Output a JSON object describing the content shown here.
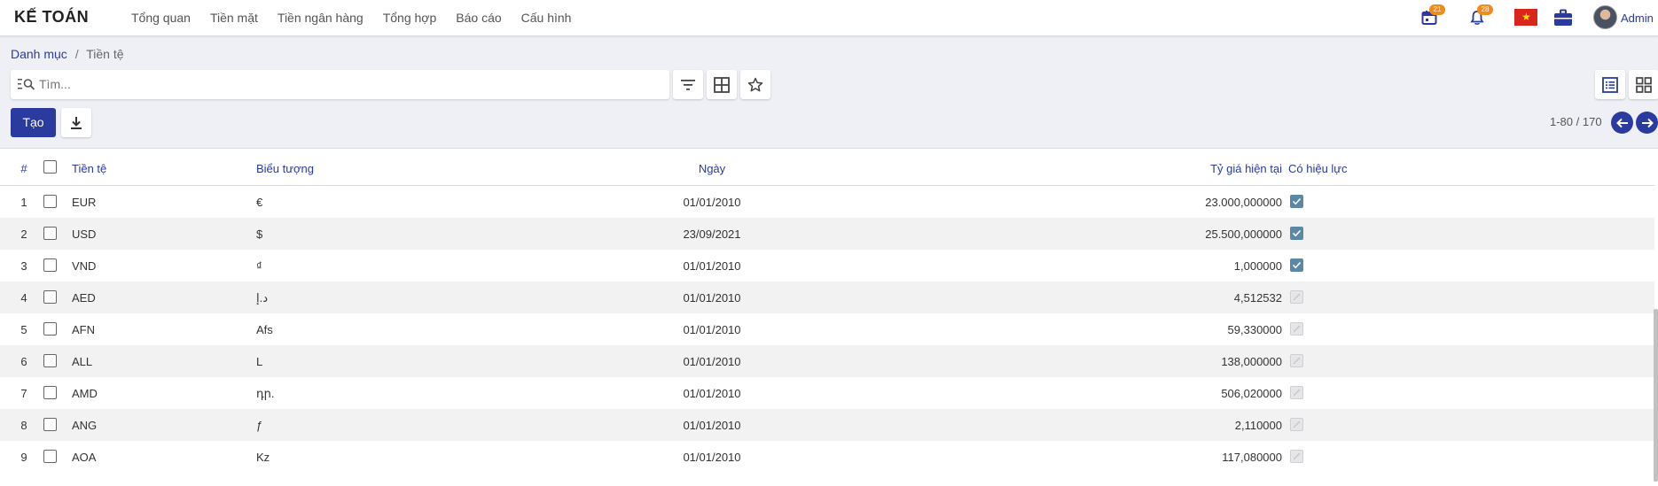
{
  "app": {
    "brand": "KẾ TOÁN",
    "menu": [
      "Tổng quan",
      "Tiền mặt",
      "Tiền ngân hàng",
      "Tổng hợp",
      "Báo cáo",
      "Cấu hình"
    ],
    "calendar_badge": "21",
    "notification_badge": "28",
    "user_name": "Admin"
  },
  "breadcrumb": {
    "parent": "Danh mục",
    "separator": "/",
    "current": "Tiền tệ"
  },
  "search": {
    "placeholder": "Tìm..."
  },
  "toolbar": {
    "create_label": "Tạo",
    "pager_text": "1-80 / 170"
  },
  "table": {
    "headers": {
      "num": "#",
      "currency": "Tiền tệ",
      "symbol": "Biểu tượng",
      "date": "Ngày",
      "rate": "Tỷ giá hiện tại",
      "active": "Có hiệu lực"
    },
    "rows": [
      {
        "num": "1",
        "currency": "EUR",
        "symbol": "€",
        "date": "01/01/2010",
        "rate": "23.000,000000",
        "active": true
      },
      {
        "num": "2",
        "currency": "USD",
        "symbol": "$",
        "date": "23/09/2021",
        "rate": "25.500,000000",
        "active": true
      },
      {
        "num": "3",
        "currency": "VND",
        "symbol": "₫",
        "date": "01/01/2010",
        "rate": "1,000000",
        "active": true
      },
      {
        "num": "4",
        "currency": "AED",
        "symbol": "د.إ",
        "date": "01/01/2010",
        "rate": "4,512532",
        "active": false
      },
      {
        "num": "5",
        "currency": "AFN",
        "symbol": "Afs",
        "date": "01/01/2010",
        "rate": "59,330000",
        "active": false
      },
      {
        "num": "6",
        "currency": "ALL",
        "symbol": "L",
        "date": "01/01/2010",
        "rate": "138,000000",
        "active": false
      },
      {
        "num": "7",
        "currency": "AMD",
        "symbol": "դր.",
        "date": "01/01/2010",
        "rate": "506,020000",
        "active": false
      },
      {
        "num": "8",
        "currency": "ANG",
        "symbol": "ƒ",
        "date": "01/01/2010",
        "rate": "2,110000",
        "active": false
      },
      {
        "num": "9",
        "currency": "AOA",
        "symbol": "Kz",
        "date": "01/01/2010",
        "rate": "117,080000",
        "active": false
      }
    ]
  },
  "colors": {
    "primary": "#2a3a9e",
    "badge": "#f28b1c",
    "active_checkbox": "#5a89a8"
  },
  "icons": [
    "calendar-icon",
    "bell-icon",
    "vn-flag-icon",
    "briefcase-icon",
    "filter-icon",
    "group-by-icon",
    "star-icon",
    "list-view-icon",
    "kanban-view-icon",
    "download-icon",
    "arrow-left-icon",
    "arrow-right-icon",
    "search-icon"
  ]
}
